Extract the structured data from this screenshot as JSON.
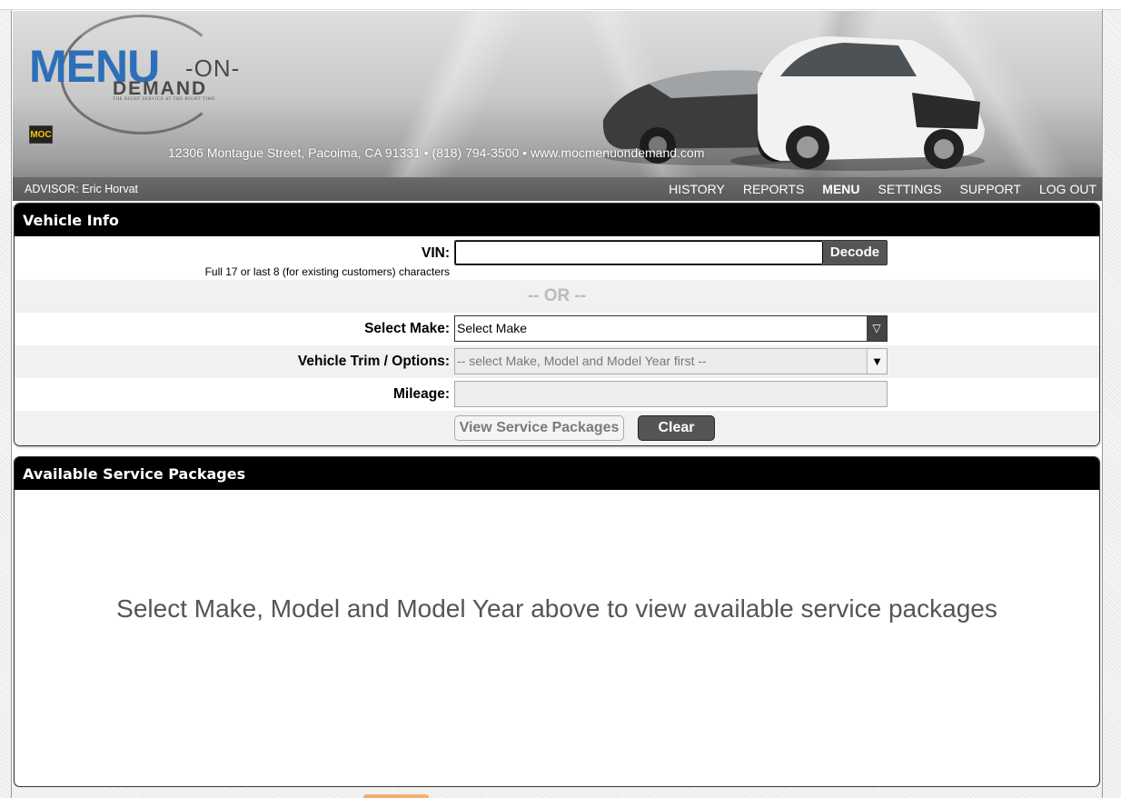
{
  "header": {
    "logo": {
      "brand": "MENU",
      "on": "-ON-",
      "demand": "DEMAND",
      "tagline": "THE RIGHT SERVICE AT THE RIGHT TIME",
      "badge": "MOC"
    },
    "address": "12306 Montague Street, Pacoima, CA 91331 • (818) 794-3500 • www.mocmenuondemand.com",
    "advisor": "ADVISOR: Eric Horvat",
    "nav": [
      "HISTORY",
      "REPORTS",
      "MENU",
      "SETTINGS",
      "SUPPORT",
      "LOG OUT"
    ],
    "active_nav": "MENU"
  },
  "vehicle_info": {
    "title": "Vehicle Info",
    "vin_label": "VIN:",
    "vin_hint": "Full 17 or last 8 (for existing customers) characters",
    "vin_value": "",
    "decode_label": "Decode",
    "or_text": "-- OR --",
    "make_label": "Select Make:",
    "make_value": "Select Make",
    "trim_label": "Vehicle Trim / Options:",
    "trim_value": "-- select Make, Model and Model Year first --",
    "mileage_label": "Mileage:",
    "mileage_value": "",
    "view_packages_label": "View Service Packages",
    "clear_label": "Clear"
  },
  "packages": {
    "title": "Available Service Packages",
    "empty_message": "Select Make, Model and Model Year above to view available service packages"
  },
  "colors": {
    "panel_header": "#000000",
    "brand_blue": "#2d6fb8",
    "button_dark": "#555555"
  }
}
